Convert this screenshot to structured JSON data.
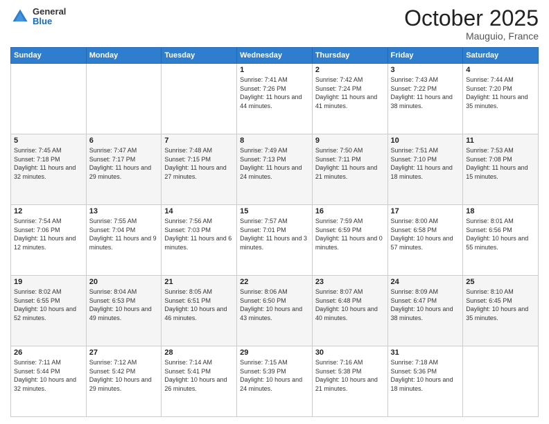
{
  "header": {
    "logo": {
      "general": "General",
      "blue": "Blue"
    },
    "month": "October 2025",
    "location": "Mauguio, France"
  },
  "days_of_week": [
    "Sunday",
    "Monday",
    "Tuesday",
    "Wednesday",
    "Thursday",
    "Friday",
    "Saturday"
  ],
  "weeks": [
    [
      {
        "day": "",
        "info": ""
      },
      {
        "day": "",
        "info": ""
      },
      {
        "day": "",
        "info": ""
      },
      {
        "day": "1",
        "info": "Sunrise: 7:41 AM\nSunset: 7:26 PM\nDaylight: 11 hours and 44 minutes."
      },
      {
        "day": "2",
        "info": "Sunrise: 7:42 AM\nSunset: 7:24 PM\nDaylight: 11 hours and 41 minutes."
      },
      {
        "day": "3",
        "info": "Sunrise: 7:43 AM\nSunset: 7:22 PM\nDaylight: 11 hours and 38 minutes."
      },
      {
        "day": "4",
        "info": "Sunrise: 7:44 AM\nSunset: 7:20 PM\nDaylight: 11 hours and 35 minutes."
      }
    ],
    [
      {
        "day": "5",
        "info": "Sunrise: 7:45 AM\nSunset: 7:18 PM\nDaylight: 11 hours and 32 minutes."
      },
      {
        "day": "6",
        "info": "Sunrise: 7:47 AM\nSunset: 7:17 PM\nDaylight: 11 hours and 29 minutes."
      },
      {
        "day": "7",
        "info": "Sunrise: 7:48 AM\nSunset: 7:15 PM\nDaylight: 11 hours and 27 minutes."
      },
      {
        "day": "8",
        "info": "Sunrise: 7:49 AM\nSunset: 7:13 PM\nDaylight: 11 hours and 24 minutes."
      },
      {
        "day": "9",
        "info": "Sunrise: 7:50 AM\nSunset: 7:11 PM\nDaylight: 11 hours and 21 minutes."
      },
      {
        "day": "10",
        "info": "Sunrise: 7:51 AM\nSunset: 7:10 PM\nDaylight: 11 hours and 18 minutes."
      },
      {
        "day": "11",
        "info": "Sunrise: 7:53 AM\nSunset: 7:08 PM\nDaylight: 11 hours and 15 minutes."
      }
    ],
    [
      {
        "day": "12",
        "info": "Sunrise: 7:54 AM\nSunset: 7:06 PM\nDaylight: 11 hours and 12 minutes."
      },
      {
        "day": "13",
        "info": "Sunrise: 7:55 AM\nSunset: 7:04 PM\nDaylight: 11 hours and 9 minutes."
      },
      {
        "day": "14",
        "info": "Sunrise: 7:56 AM\nSunset: 7:03 PM\nDaylight: 11 hours and 6 minutes."
      },
      {
        "day": "15",
        "info": "Sunrise: 7:57 AM\nSunset: 7:01 PM\nDaylight: 11 hours and 3 minutes."
      },
      {
        "day": "16",
        "info": "Sunrise: 7:59 AM\nSunset: 6:59 PM\nDaylight: 11 hours and 0 minutes."
      },
      {
        "day": "17",
        "info": "Sunrise: 8:00 AM\nSunset: 6:58 PM\nDaylight: 10 hours and 57 minutes."
      },
      {
        "day": "18",
        "info": "Sunrise: 8:01 AM\nSunset: 6:56 PM\nDaylight: 10 hours and 55 minutes."
      }
    ],
    [
      {
        "day": "19",
        "info": "Sunrise: 8:02 AM\nSunset: 6:55 PM\nDaylight: 10 hours and 52 minutes."
      },
      {
        "day": "20",
        "info": "Sunrise: 8:04 AM\nSunset: 6:53 PM\nDaylight: 10 hours and 49 minutes."
      },
      {
        "day": "21",
        "info": "Sunrise: 8:05 AM\nSunset: 6:51 PM\nDaylight: 10 hours and 46 minutes."
      },
      {
        "day": "22",
        "info": "Sunrise: 8:06 AM\nSunset: 6:50 PM\nDaylight: 10 hours and 43 minutes."
      },
      {
        "day": "23",
        "info": "Sunrise: 8:07 AM\nSunset: 6:48 PM\nDaylight: 10 hours and 40 minutes."
      },
      {
        "day": "24",
        "info": "Sunrise: 8:09 AM\nSunset: 6:47 PM\nDaylight: 10 hours and 38 minutes."
      },
      {
        "day": "25",
        "info": "Sunrise: 8:10 AM\nSunset: 6:45 PM\nDaylight: 10 hours and 35 minutes."
      }
    ],
    [
      {
        "day": "26",
        "info": "Sunrise: 7:11 AM\nSunset: 5:44 PM\nDaylight: 10 hours and 32 minutes."
      },
      {
        "day": "27",
        "info": "Sunrise: 7:12 AM\nSunset: 5:42 PM\nDaylight: 10 hours and 29 minutes."
      },
      {
        "day": "28",
        "info": "Sunrise: 7:14 AM\nSunset: 5:41 PM\nDaylight: 10 hours and 26 minutes."
      },
      {
        "day": "29",
        "info": "Sunrise: 7:15 AM\nSunset: 5:39 PM\nDaylight: 10 hours and 24 minutes."
      },
      {
        "day": "30",
        "info": "Sunrise: 7:16 AM\nSunset: 5:38 PM\nDaylight: 10 hours and 21 minutes."
      },
      {
        "day": "31",
        "info": "Sunrise: 7:18 AM\nSunset: 5:36 PM\nDaylight: 10 hours and 18 minutes."
      },
      {
        "day": "",
        "info": ""
      }
    ]
  ]
}
